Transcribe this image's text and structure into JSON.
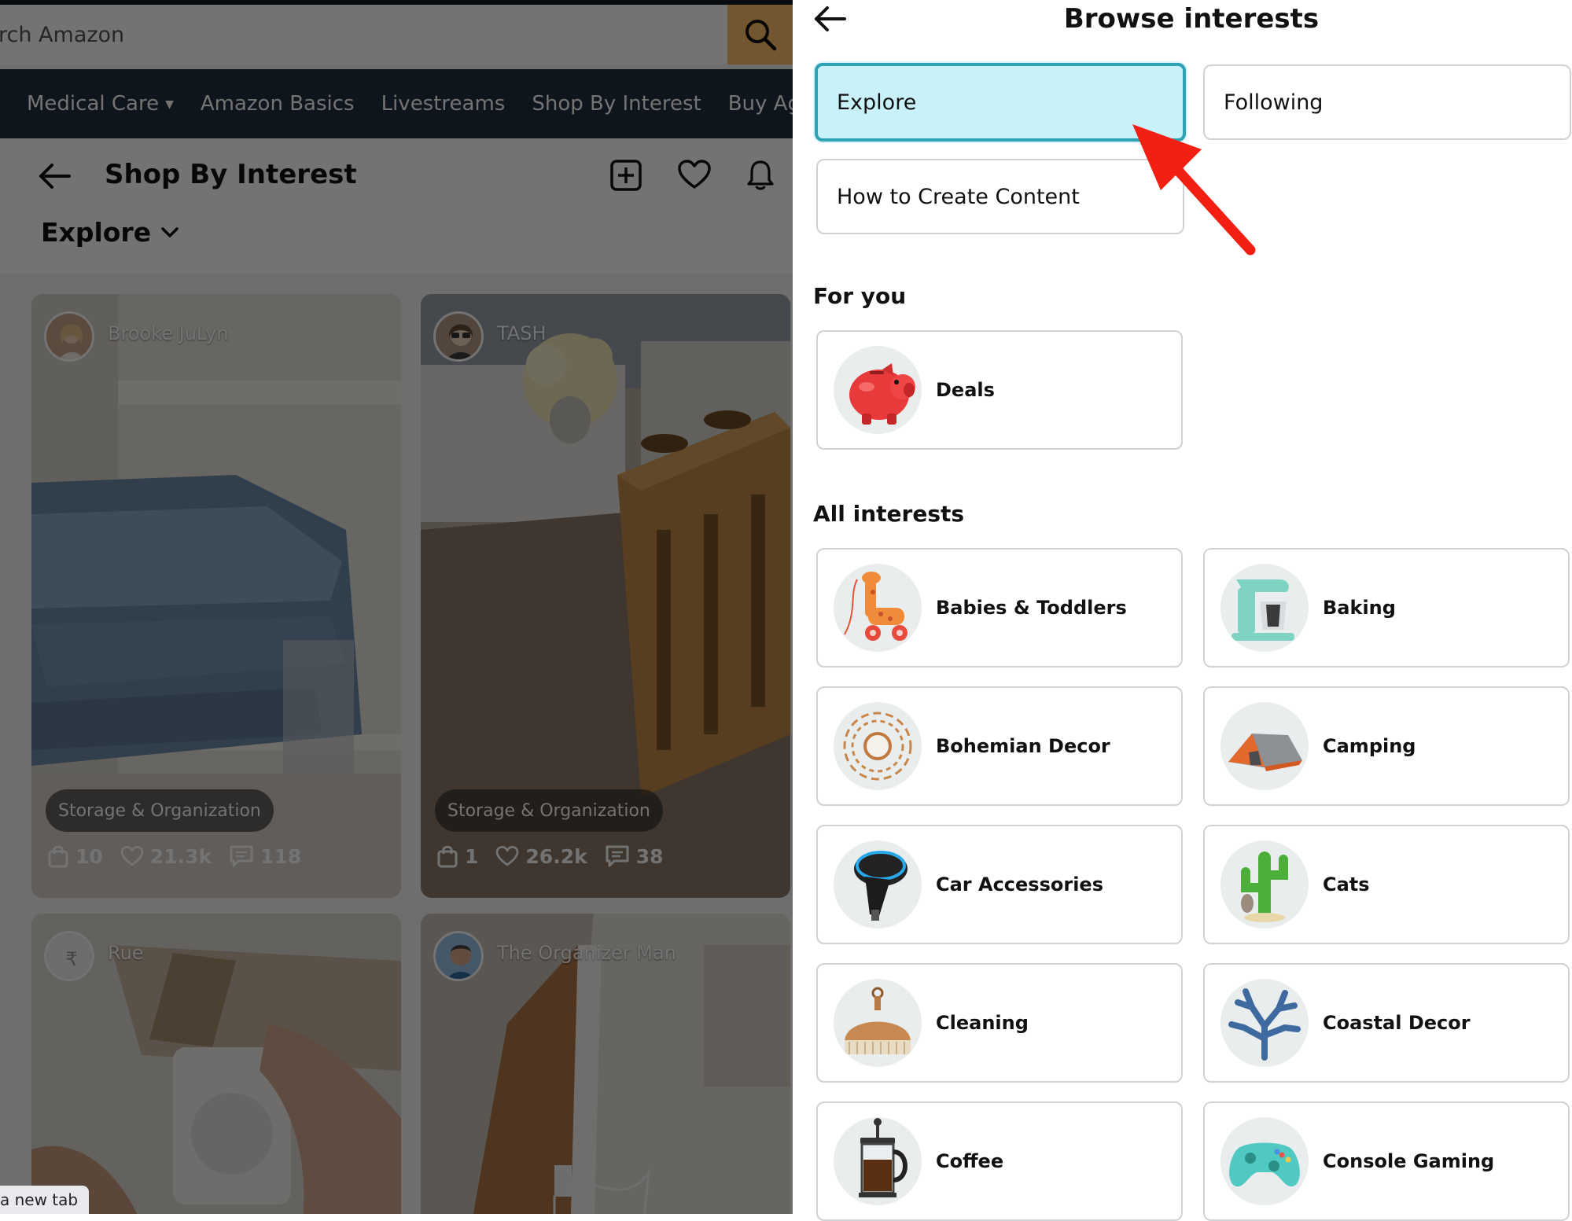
{
  "browser": {
    "search": {
      "value": "rch Amazon"
    },
    "nav": [
      {
        "label": "Medical Care",
        "has_caret": true
      },
      {
        "label": "Amazon Basics"
      },
      {
        "label": "Livestreams"
      },
      {
        "label": "Shop By Interest"
      },
      {
        "label": "Buy Again"
      }
    ],
    "tooltip": "a new tab"
  },
  "left_page": {
    "title": "Shop By Interest",
    "dropdown": "Explore",
    "cards": [
      {
        "author": "Brooke JuLyn",
        "tag": "Storage & Organization",
        "bag": "10",
        "likes": "21.3k",
        "comments": "118"
      },
      {
        "author": "TASH",
        "tag": "Storage & Organization",
        "bag": "1",
        "likes": "26.2k",
        "comments": "38"
      },
      {
        "author": "Rue"
      },
      {
        "author": "The Organizer Man"
      }
    ]
  },
  "panel": {
    "title": "Browse interests",
    "tabs": [
      {
        "label": "Explore",
        "active": true
      },
      {
        "label": "Following",
        "active": false
      },
      {
        "label": "How to Create Content",
        "active": false
      }
    ],
    "for_you_heading": "For you",
    "for_you": [
      {
        "label": "Deals",
        "icon": "piggy-bank"
      }
    ],
    "all_heading": "All interests",
    "interests": [
      {
        "label": "Babies & Toddlers",
        "icon": "giraffe-toy"
      },
      {
        "label": "Baking",
        "icon": "stand-mixer"
      },
      {
        "label": "Bohemian Decor",
        "icon": "rattan-mirror"
      },
      {
        "label": "Camping",
        "icon": "tent"
      },
      {
        "label": "Car Accessories",
        "icon": "car-charger"
      },
      {
        "label": "Cats",
        "icon": "cactus-cat-tree"
      },
      {
        "label": "Cleaning",
        "icon": "dust-brush"
      },
      {
        "label": "Coastal Decor",
        "icon": "coral"
      },
      {
        "label": "Coffee",
        "icon": "french-press"
      },
      {
        "label": "Console Gaming",
        "icon": "game-controller"
      }
    ]
  },
  "annotation": {
    "color": "#f31f12"
  }
}
